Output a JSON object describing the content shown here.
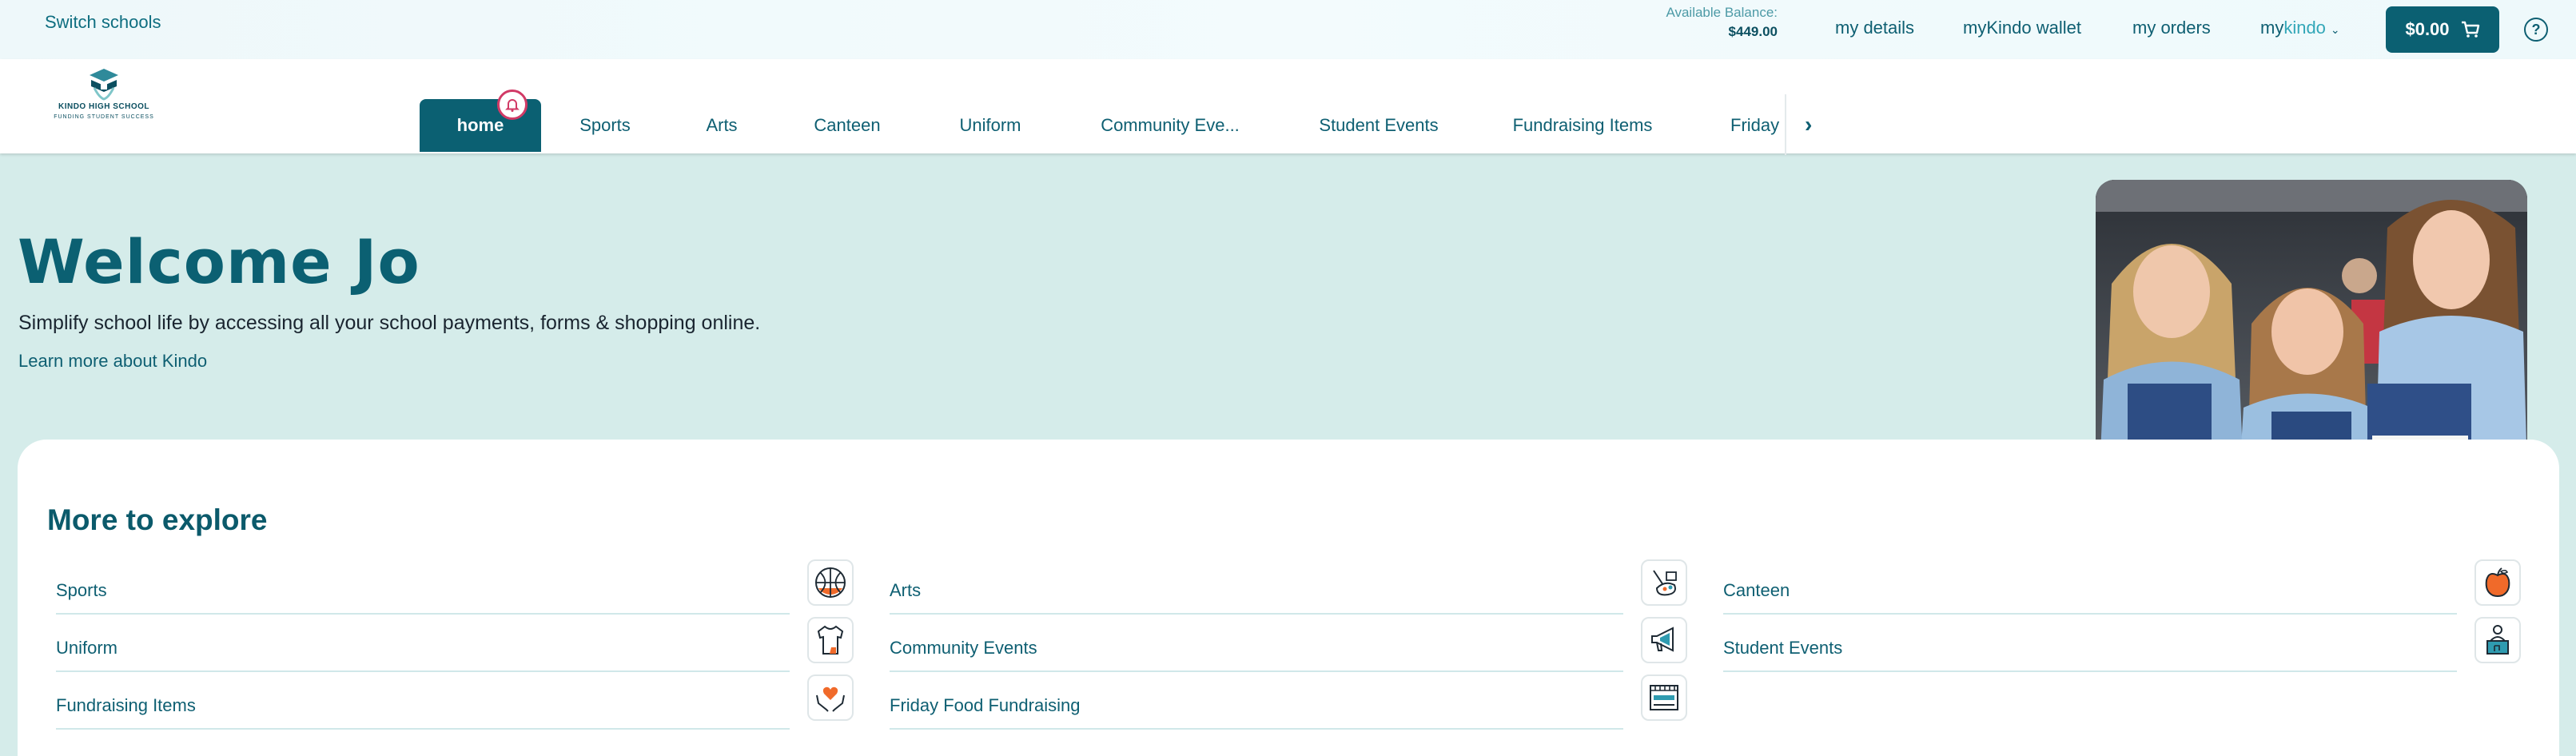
{
  "topbar": {
    "switch_schools": "Switch schools",
    "balance_label": "Available Balance:",
    "balance_value": "$449.00",
    "links": [
      "my details",
      "myKindo wallet",
      "my orders"
    ],
    "mykindo_prefix": "my",
    "mykindo_suffix": "kindo",
    "cart_total": "$0.00"
  },
  "school": {
    "name": "KINDO HIGH SCHOOL",
    "tagline": "FUNDING STUDENT SUCCESS"
  },
  "nav": {
    "tabs": [
      "home",
      "Sports",
      "Arts",
      "Canteen",
      "Uniform",
      "Community Eve...",
      "Student Events",
      "Fundraising Items",
      "Friday F"
    ]
  },
  "hero": {
    "welcome": "Welcome Jo",
    "tagline": "Simplify school life by accessing all your school payments, forms & shopping online.",
    "learn_more": "Learn more about Kindo"
  },
  "explore": {
    "title": "More to explore",
    "items": [
      {
        "label": "Sports",
        "icon": "basketball-icon"
      },
      {
        "label": "Arts",
        "icon": "art-palette-icon"
      },
      {
        "label": "Canteen",
        "icon": "apple-icon"
      },
      {
        "label": "Uniform",
        "icon": "shirt-icon"
      },
      {
        "label": "Community Events",
        "icon": "megaphone-icon"
      },
      {
        "label": "Student Events",
        "icon": "student-podium-icon"
      },
      {
        "label": "Fundraising Items",
        "icon": "heart-hands-icon"
      },
      {
        "label": "Friday Food Fundraising",
        "icon": "food-tray-icon"
      }
    ]
  },
  "colors": {
    "brand_dark": "#0b6072",
    "hero_bg": "#d5ecea",
    "accent_orange": "#f06a2a",
    "notification": "#d13a66"
  }
}
